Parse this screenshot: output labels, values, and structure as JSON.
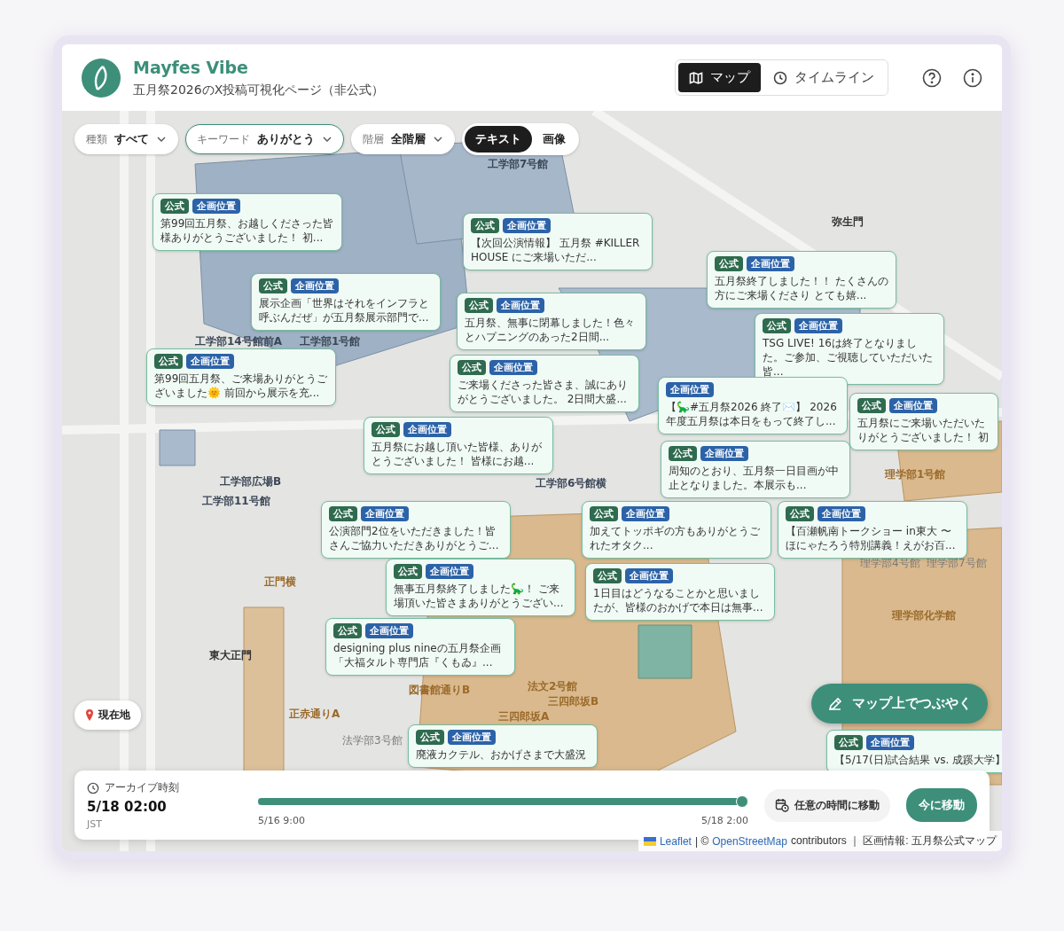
{
  "header": {
    "title": "Mayfes Vibe",
    "subtitle": "五月祭2026のX投稿可視化ページ（非公式）",
    "nav": [
      {
        "label": "マップ",
        "selected": true
      },
      {
        "label": "タイムライン",
        "selected": false
      }
    ]
  },
  "filters": [
    {
      "label": "種類",
      "value": "すべて",
      "active": false
    },
    {
      "label": "キーワード",
      "value": "ありがとう",
      "active": true
    },
    {
      "label": "階層",
      "value": "全階層",
      "active": false
    }
  ],
  "view_toggle": [
    {
      "label": "テキスト",
      "selected": true
    },
    {
      "label": "画像",
      "selected": false
    }
  ],
  "map_labels": [
    {
      "text": "工学部7号館",
      "kind": "building"
    },
    {
      "text": "弥生門",
      "kind": "gate"
    },
    {
      "text": "工学部14号館前A",
      "kind": "building"
    },
    {
      "text": "工学部1号館",
      "kind": "building"
    },
    {
      "text": "工学部広場B",
      "kind": "building"
    },
    {
      "text": "工学部6号館横",
      "kind": "building"
    },
    {
      "text": "工学部11号館",
      "kind": "building"
    },
    {
      "text": "理学部1号館",
      "kind": "venue"
    },
    {
      "text": "理学部4号館",
      "kind": "gray"
    },
    {
      "text": "理学部7号館",
      "kind": "gray"
    },
    {
      "text": "理学部化学館",
      "kind": "venue"
    },
    {
      "text": "正門横",
      "kind": "venue"
    },
    {
      "text": "東大正門",
      "kind": "gate"
    },
    {
      "text": "図書館通りB",
      "kind": "venue"
    },
    {
      "text": "法文2号館",
      "kind": "venue"
    },
    {
      "text": "三四郎坂B",
      "kind": "venue"
    },
    {
      "text": "三四郎坂A",
      "kind": "venue"
    },
    {
      "text": "正赤通りA",
      "kind": "venue"
    },
    {
      "text": "法学部3号館",
      "kind": "gray"
    }
  ],
  "posts": [
    {
      "tags": [
        {
          "label": "公式",
          "kind": "official"
        },
        {
          "label": "企画位置",
          "kind": "location"
        }
      ],
      "text": "第99回五月祭、お越しくださった皆様ありがとうございました！ 初..."
    },
    {
      "tags": [
        {
          "label": "公式",
          "kind": "official"
        },
        {
          "label": "企画位置",
          "kind": "location"
        }
      ],
      "text": "【次回公演情報】 五月祭 #KILLERHOUSE にご来場いただ..."
    },
    {
      "tags": [
        {
          "label": "公式",
          "kind": "official"
        },
        {
          "label": "企画位置",
          "kind": "location"
        }
      ],
      "text": "五月祭終了しました！！ たくさんの方にご来場くださり とても嬉..."
    },
    {
      "tags": [
        {
          "label": "公式",
          "kind": "official"
        },
        {
          "label": "企画位置",
          "kind": "location"
        }
      ],
      "text": "展示企画「世界はそれをインフラと呼ぶんだぜ」が五月祭展示部門で..."
    },
    {
      "tags": [
        {
          "label": "公式",
          "kind": "official"
        },
        {
          "label": "企画位置",
          "kind": "location"
        }
      ],
      "text": "五月祭、無事に閉幕しました！色々とハプニングのあった2日間..."
    },
    {
      "tags": [
        {
          "label": "公式",
          "kind": "official"
        },
        {
          "label": "企画位置",
          "kind": "location"
        }
      ],
      "text": "TSG LIVE! 16は終了となりました。ご参加、ご視聴していただいた皆..."
    },
    {
      "tags": [
        {
          "label": "公式",
          "kind": "official"
        },
        {
          "label": "企画位置",
          "kind": "location"
        }
      ],
      "text": "第99回五月祭、ご来場ありがとうございました🌞 前回から展示を充..."
    },
    {
      "tags": [
        {
          "label": "公式",
          "kind": "official"
        },
        {
          "label": "企画位置",
          "kind": "location"
        }
      ],
      "text": "ご来場くださった皆さま、誠にありがとうございました。 2日間大盛..."
    },
    {
      "tags": [
        {
          "label": "企画位置",
          "kind": "location"
        }
      ],
      "text": "【🦕#五月祭2026 終了✉️】 2026年度五月祭は本日をもって終了し..."
    },
    {
      "tags": [
        {
          "label": "公式",
          "kind": "official"
        },
        {
          "label": "企画位置",
          "kind": "location"
        }
      ],
      "text": "五月祭にご来場いただいたりがとうございました！ 初"
    },
    {
      "tags": [
        {
          "label": "公式",
          "kind": "official"
        },
        {
          "label": "企画位置",
          "kind": "location"
        }
      ],
      "text": "五月祭にお越し頂いた皆様、ありがとうございました！ 皆様にお越..."
    },
    {
      "tags": [
        {
          "label": "公式",
          "kind": "official"
        },
        {
          "label": "企画位置",
          "kind": "location"
        }
      ],
      "text": "周知のとおり、五月祭一日目画が中止となりました。本展示も..."
    },
    {
      "tags": [
        {
          "label": "公式",
          "kind": "official"
        },
        {
          "label": "企画位置",
          "kind": "location"
        }
      ],
      "text": "公演部門2位をいただきました！皆さんご協力いただきありがとうご..."
    },
    {
      "tags": [
        {
          "label": "公式",
          "kind": "official"
        },
        {
          "label": "企画位置",
          "kind": "location"
        }
      ],
      "text": "加えてトッポギの方もありがとうごれたオタク..."
    },
    {
      "tags": [
        {
          "label": "公式",
          "kind": "official"
        },
        {
          "label": "企画位置",
          "kind": "location"
        }
      ],
      "text": "【百瀬帆南トークショー in東大 〜ほにゃたろう特別講義！えがお百..."
    },
    {
      "tags": [
        {
          "label": "公式",
          "kind": "official"
        },
        {
          "label": "企画位置",
          "kind": "location"
        }
      ],
      "text": "無事五月祭終了しました🦕！ ご来場頂いた皆さまありがとうござい..."
    },
    {
      "tags": [
        {
          "label": "公式",
          "kind": "official"
        },
        {
          "label": "企画位置",
          "kind": "location"
        }
      ],
      "text": "1日目はどうなることかと思いましたが、皆様のおかげで本日は無事..."
    },
    {
      "tags": [
        {
          "label": "公式",
          "kind": "official"
        },
        {
          "label": "企画位置",
          "kind": "location"
        }
      ],
      "text": "designing plus nineの五月祭企画「大福タルト専門店『くもゐ』..."
    },
    {
      "tags": [
        {
          "label": "公式",
          "kind": "official"
        },
        {
          "label": "企画位置",
          "kind": "location"
        }
      ],
      "text": "廃液カクテル、おかげさまで大盛況"
    },
    {
      "tags": [
        {
          "label": "公式",
          "kind": "official"
        },
        {
          "label": "企画位置",
          "kind": "location"
        }
      ],
      "text": "【5/17(日)試合結果 vs. 成蹊大学】"
    }
  ],
  "locate_button": "現在地",
  "post_button": "マップ上でつぶやく",
  "timeline": {
    "label": "アーカイブ時刻",
    "time": "5/18 02:00",
    "zone": "JST",
    "slider": {
      "level": 1.0
    },
    "start": "5/16 9:00",
    "end": "5/18 2:00",
    "pick_button": "任意の時間に移動",
    "now_button": "今に移動"
  },
  "attribution": {
    "leaflet": "Leaflet",
    "mid": "| ©",
    "osm": "OpenStreetMap",
    "rest": "contributors ｜ 区画情報: 五月祭公式マップ"
  }
}
